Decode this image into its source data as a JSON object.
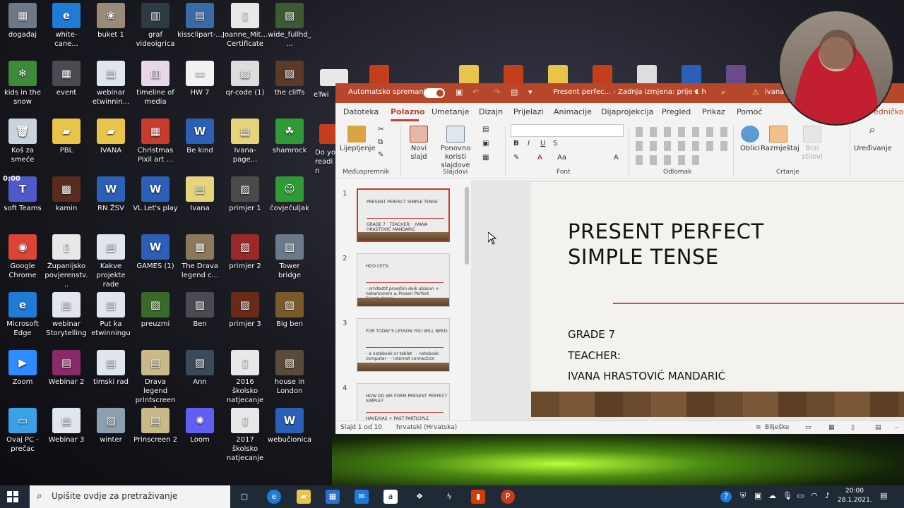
{
  "desktop": {
    "icons": [
      {
        "label": "događaj",
        "color": "#6b7a86",
        "glyph": "▦"
      },
      {
        "label": "white-cane...",
        "color": "#1e7bd6",
        "glyph": "e"
      },
      {
        "label": "buket 1",
        "color": "#9a8a7a",
        "glyph": "❀"
      },
      {
        "label": "graf videoigrica",
        "color": "#2e3a44",
        "glyph": "▥"
      },
      {
        "label": "kissclipart-...",
        "color": "#3a6aa8",
        "glyph": "▤"
      },
      {
        "label": "Joanne_Mit... Certificate",
        "color": "#e8e8e8",
        "glyph": "▯"
      },
      {
        "label": "wide_fullhd_...",
        "color": "#3e5a34",
        "glyph": "▧"
      },
      {
        "label": "kids in the snow",
        "color": "#3c8a3a",
        "glyph": "❄"
      },
      {
        "label": "event",
        "color": "#4a4a52",
        "glyph": "▦"
      },
      {
        "label": "webinar etwinnin...",
        "color": "#dfe6ee",
        "glyph": "▤"
      },
      {
        "label": "timeline of media",
        "color": "#e7d7e8",
        "glyph": "▥"
      },
      {
        "label": "HW 7",
        "color": "#f2f2f2",
        "glyph": "▭"
      },
      {
        "label": "qr-code (1)",
        "color": "#dddddd",
        "glyph": "▩"
      },
      {
        "label": "the cliffs",
        "color": "#5b3a2a",
        "glyph": "▨"
      },
      {
        "label": "Koš za smeće",
        "color": "#c9d4df",
        "glyph": "🗑"
      },
      {
        "label": "PBL",
        "color": "#e9c34a",
        "glyph": "▰"
      },
      {
        "label": "IVANA",
        "color": "#e9c34a",
        "glyph": "▰"
      },
      {
        "label": "Christmas Pixil art ...",
        "color": "#c83c2e",
        "glyph": "▦"
      },
      {
        "label": "Be kind",
        "color": "#2b5fb8",
        "glyph": "W"
      },
      {
        "label": "Ivana-page...",
        "color": "#e6d37a",
        "glyph": "▤"
      },
      {
        "label": "shamrock",
        "color": "#2f9a36",
        "glyph": "☘"
      },
      {
        "label": "soft Teams",
        "color": "#5059c9",
        "glyph": "T"
      },
      {
        "label": "kamin",
        "color": "#5a2c1e",
        "glyph": "▩"
      },
      {
        "label": "RN ŽSV",
        "color": "#2b5fb8",
        "glyph": "W"
      },
      {
        "label": "VL Let's play",
        "color": "#2b5fb8",
        "glyph": "W"
      },
      {
        "label": "Ivana",
        "color": "#e6d37a",
        "glyph": "▤"
      },
      {
        "label": "primjer 1",
        "color": "#4a4a4a",
        "glyph": "▨"
      },
      {
        "label": "čovječuljak",
        "color": "#2f9a36",
        "glyph": "☺"
      },
      {
        "label": "Google Chrome",
        "color": "#db4437",
        "glyph": "◉"
      },
      {
        "label": "Županijsko povjerenstv...",
        "color": "#e8e8e8",
        "glyph": "▯"
      },
      {
        "label": "Kakve projekte rade",
        "color": "#dfe6ee",
        "glyph": "▤"
      },
      {
        "label": "GAMES (1)",
        "color": "#2b5fb8",
        "glyph": "W"
      },
      {
        "label": "The Drava legend c...",
        "color": "#8a7a5a",
        "glyph": "▦"
      },
      {
        "label": "primjer 2",
        "color": "#9a2a2a",
        "glyph": "▨"
      },
      {
        "label": "Tower bridge",
        "color": "#6a7a8a",
        "glyph": "▨"
      },
      {
        "label": "Microsoft Edge",
        "color": "#1e7bd6",
        "glyph": "e"
      },
      {
        "label": "webinar Storytelling",
        "color": "#dfe6ee",
        "glyph": "▤"
      },
      {
        "label": "Put ka etwinningu",
        "color": "#dfe6ee",
        "glyph": "▤"
      },
      {
        "label": "preuzmi",
        "color": "#3a6a2a",
        "glyph": "▨"
      },
      {
        "label": "Ben",
        "color": "#4a4a52",
        "glyph": "▨"
      },
      {
        "label": "primjer 3",
        "color": "#6a2a1a",
        "glyph": "▨"
      },
      {
        "label": "Big ben",
        "color": "#7a5a2a",
        "glyph": "▨"
      },
      {
        "label": "Zoom",
        "color": "#2d8cff",
        "glyph": "▶"
      },
      {
        "label": "Webinar 2",
        "color": "#8a2a6a",
        "glyph": "▤"
      },
      {
        "label": "timski rad",
        "color": "#dfe6ee",
        "glyph": "▤"
      },
      {
        "label": "Drava legend printscreen 1",
        "color": "#c9b98a",
        "glyph": "▤"
      },
      {
        "label": "Ann",
        "color": "#3a4a5a",
        "glyph": "▨"
      },
      {
        "label": "2016 školsko natjecanje ...",
        "color": "#e8e8e8",
        "glyph": "▯"
      },
      {
        "label": "house in London",
        "color": "#5a4a3a",
        "glyph": "▨"
      },
      {
        "label": "Ovaj PC - prečac",
        "color": "#3aa0e8",
        "glyph": "▭"
      },
      {
        "label": "Webinar 3",
        "color": "#dfe6ee",
        "glyph": "▤"
      },
      {
        "label": "winter",
        "color": "#8aa0b0",
        "glyph": "▨"
      },
      {
        "label": "Prinscreen 2",
        "color": "#c9b98a",
        "glyph": "▤"
      },
      {
        "label": "Loom",
        "color": "#625df5",
        "glyph": "✺"
      },
      {
        "label": "2017 školsko natjecanje",
        "color": "#e8e8e8",
        "glyph": "▯"
      },
      {
        "label": "webučionica",
        "color": "#2b5fb8",
        "glyph": "W"
      }
    ],
    "partial_labels": {
      "doyo": "Do yo readin",
      "etwin": "eTwi"
    },
    "teams_time": "0:00"
  },
  "ppt": {
    "autosave_label": "Automatsko spremanje",
    "doc_title": "Present perfec...  -  Zadnja izmjena: prije 1 h",
    "user": "ivana",
    "tabs": [
      "Datoteka",
      "Polazno",
      "Umetanje",
      "Dizajn",
      "Prijelazi",
      "Animacije",
      "Dijaprojekcija",
      "Pregled",
      "Prikaz",
      "Pomoć"
    ],
    "active_tab": "Polazno",
    "share_partial": "edničko",
    "ribbon": {
      "paste": "Lijepljenje",
      "new_slide": "Novi slajd",
      "reuse": "Ponovno koristi slajdove",
      "shapes": "Oblici",
      "arrange": "Razmještaj",
      "quick_styles": "Brzi stilovi",
      "editing": "Uređivanje",
      "groups": {
        "clipboard": "Međuspremnik",
        "slides": "Slajdovi",
        "font": "Font",
        "paragraph": "Odlomak",
        "drawing": "Crtanje"
      }
    },
    "thumbnails": [
      {
        "num": "1",
        "text": "PRESENT PERFECT SIMPLE TENSE",
        "sub": "GRADE 7 · TEACHER: · IVANA HRASTOVIĆ MANDARIĆ"
      },
      {
        "num": "2",
        "text": "HOO CETS:",
        "sub": "- ornitestit proerbin deik abasun + nekamonem ≥ Prosen Perfect Simple tense"
      },
      {
        "num": "3",
        "text": "FOR TODAY'S LESSON YOU WILL NEED:",
        "sub": "- a notebook or tablet · - notebook computer · - internet connection"
      },
      {
        "num": "4",
        "text": "HOW DO WE FORM PRESENT PERFECT SIMPLE?",
        "sub": "HAVE/HAS + PAST PARTICIPLE"
      }
    ],
    "slide": {
      "title_line1": "PRESENT PERFECT",
      "title_line2": "SIMPLE TENSE",
      "grade": "GRADE 7",
      "teacher": "TEACHER:",
      "name": "IVANA HRASTOVIĆ MANDARIĆ"
    },
    "status": {
      "slide_count": "Slajd 1 od 10",
      "language": "hrvatski (Hrvatska)",
      "notes": "Bilješke"
    }
  },
  "taskbar": {
    "search_placeholder": "Upišite ovdje za pretraživanje",
    "time": "20:00",
    "date": "28.1.2021."
  },
  "colors": {
    "ppt_accent": "#b7472a",
    "taskbar": "#1f2a36"
  }
}
